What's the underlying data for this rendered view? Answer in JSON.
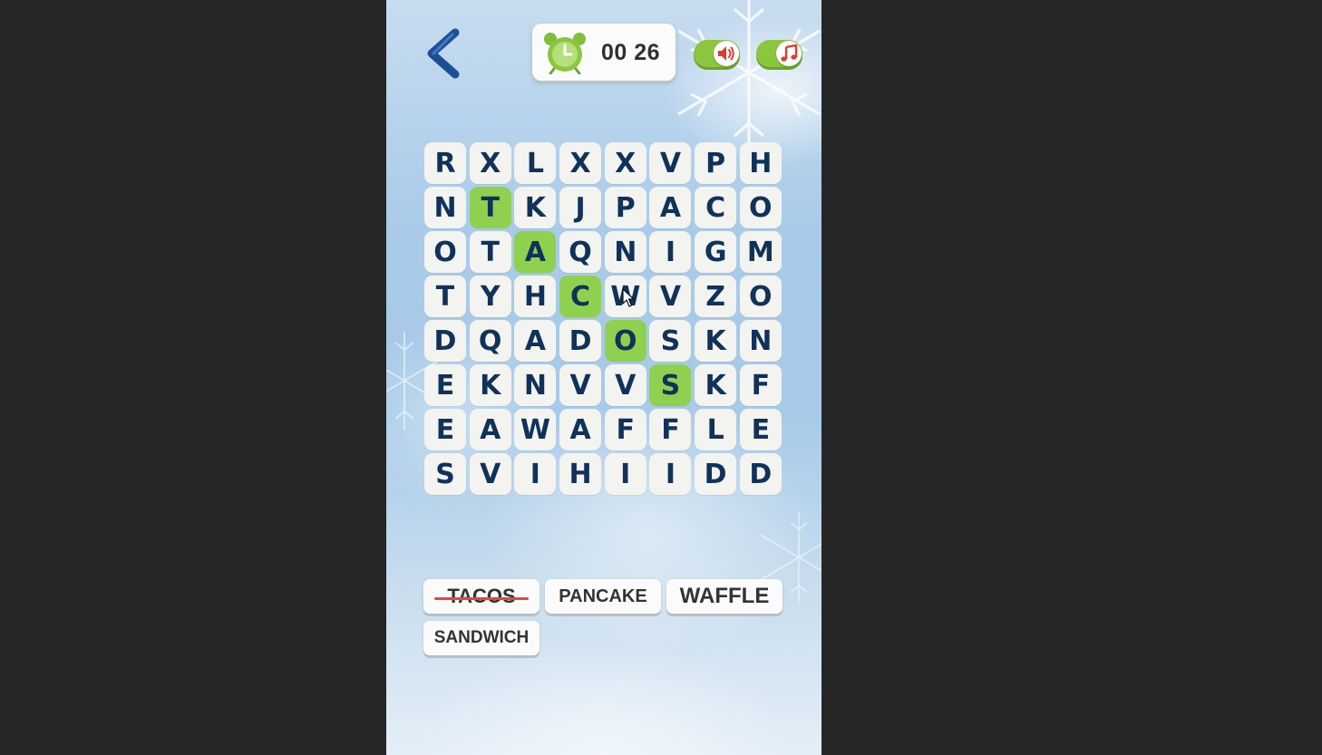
{
  "timer": {
    "text": "00 26"
  },
  "toggles": {
    "sound_on": true,
    "music_on": true
  },
  "grid": {
    "rows": [
      [
        "R",
        "X",
        "L",
        "X",
        "X",
        "V",
        "P",
        "H"
      ],
      [
        "N",
        "T",
        "K",
        "J",
        "P",
        "A",
        "C",
        "O"
      ],
      [
        "O",
        "T",
        "A",
        "Q",
        "N",
        "I",
        "G",
        "M"
      ],
      [
        "T",
        "Y",
        "H",
        "C",
        "W",
        "V",
        "Z",
        "O"
      ],
      [
        "D",
        "Q",
        "A",
        "D",
        "O",
        "S",
        "K",
        "N"
      ],
      [
        "E",
        "K",
        "N",
        "V",
        "V",
        "S",
        "K",
        "F"
      ],
      [
        "E",
        "A",
        "W",
        "A",
        "F",
        "F",
        "L",
        "E"
      ],
      [
        "S",
        "V",
        "I",
        "H",
        "I",
        "I",
        "D",
        "D"
      ]
    ],
    "highlighted": [
      [
        1,
        1
      ],
      [
        2,
        2
      ],
      [
        3,
        3
      ],
      [
        4,
        4
      ],
      [
        5,
        5
      ]
    ],
    "highlight_color": "#8fd14f"
  },
  "words": [
    {
      "text": "TACOS",
      "found": true
    },
    {
      "text": "PANCAKE",
      "found": false
    },
    {
      "text": "WAFFLE",
      "found": false
    },
    {
      "text": "SANDWICH",
      "found": false
    }
  ],
  "colors": {
    "letter": "#10325a",
    "strike": "#e3473c",
    "toggle": "#8cc63f"
  },
  "icons": {
    "back": "chevron-left-icon",
    "timer": "alarm-clock-icon",
    "sound": "speaker-icon",
    "music": "music-note-icon"
  }
}
